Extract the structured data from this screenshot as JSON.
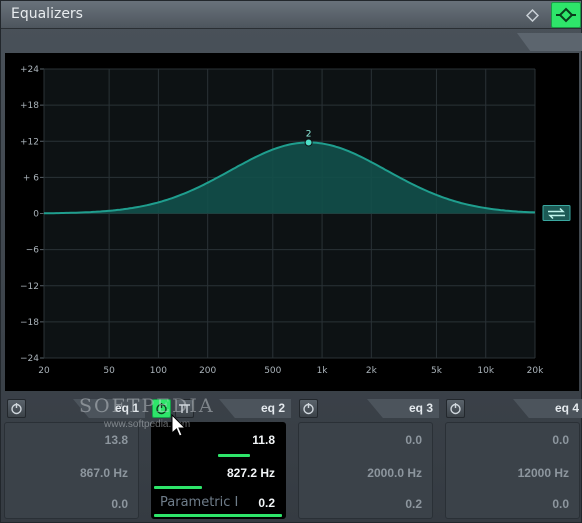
{
  "window": {
    "title": "Equalizers"
  },
  "colors": {
    "accent": "#2ee56a",
    "curve": "#1f9e8e",
    "fill": "#12504a"
  },
  "icons": {
    "diamond": "diamond-icon",
    "bypass": "bypass-icon",
    "power": "power-icon",
    "phase": "phase-toggle-icon",
    "type": "filter-type-icon"
  },
  "graph": {
    "y_labels": [
      "+24",
      "+18",
      "+12",
      "+ 6",
      "0",
      "−6",
      "−12",
      "−18",
      "−24"
    ],
    "x_labels": [
      "20",
      "50",
      "100",
      "200",
      "500",
      "1k",
      "2k",
      "5k",
      "10k",
      "20k"
    ],
    "node_label": "2"
  },
  "bands": [
    {
      "tab": "eq 1",
      "gain": "13.8",
      "freq": "867.0 Hz",
      "q": "0.0",
      "gain_fill": 0.0,
      "q_fill": 0.0
    },
    {
      "tab": "eq 2",
      "gain": "11.8",
      "freq": "827.2 Hz",
      "type": "Parametric I",
      "q": "0.2",
      "gain_fill": 0.25,
      "freq_fill": 0.38,
      "q_fill": 1.0
    },
    {
      "tab": "eq 3",
      "gain": "0.0",
      "freq": "2000.0 Hz",
      "q": "0.2"
    },
    {
      "tab": "eq 4",
      "gain": "0.0",
      "freq": "12000 Hz",
      "q": "0.0"
    }
  ],
  "watermark": {
    "text": "SOFTPEDIA",
    "url": "www.softpedia.com"
  }
}
